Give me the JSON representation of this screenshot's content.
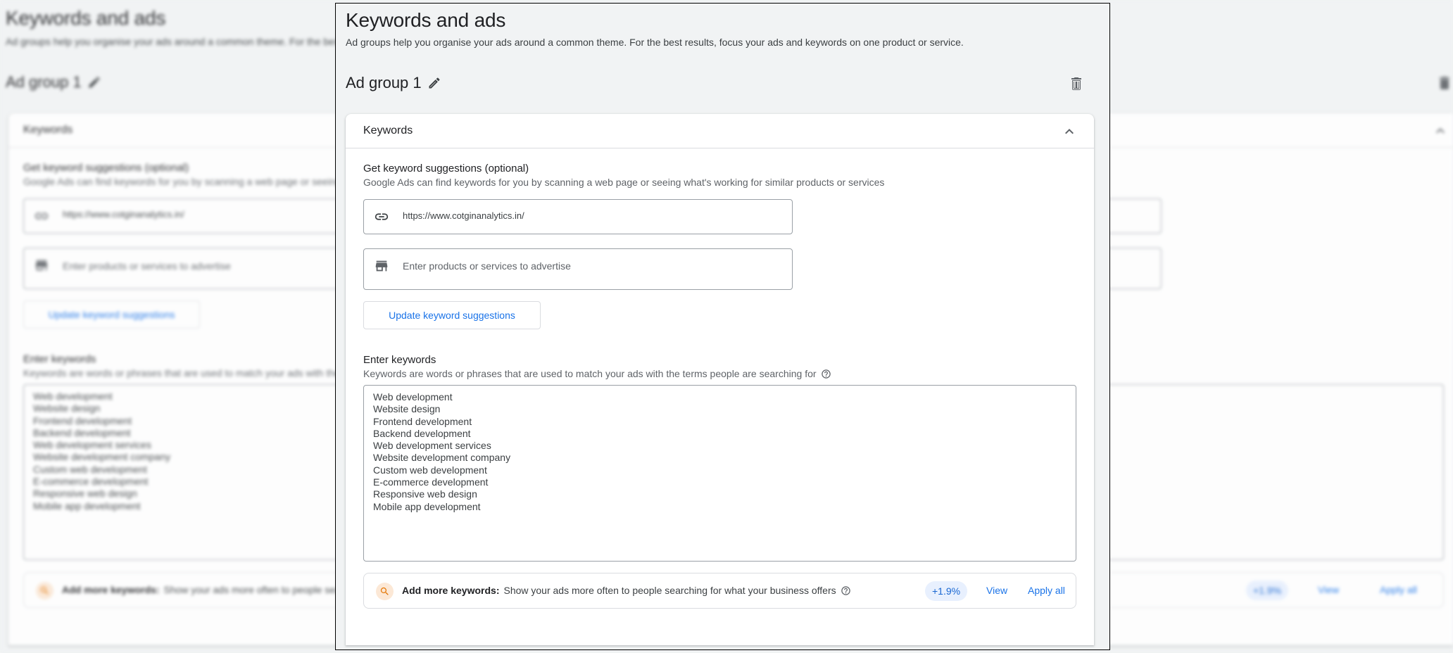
{
  "page": {
    "title": "Keywords and ads",
    "intro": "Ad groups help you organise your ads around a common theme. For the best results, focus your ads and keywords on one product or service."
  },
  "ad_group": {
    "name": "Ad group 1",
    "edit_icon": "pencil-icon",
    "delete_icon": "trash-icon"
  },
  "keywords_card": {
    "title": "Keywords",
    "collapse_icon": "chevron-up-icon",
    "suggestions": {
      "title": "Get keyword suggestions (optional)",
      "description": "Google Ads can find keywords for you by scanning a web page or seeing what's working for similar products or services",
      "url_field": {
        "icon": "link-icon",
        "value": "https://www.cotginanalytics.in/"
      },
      "products_field": {
        "icon": "storefront-icon",
        "value": "",
        "placeholder": "Enter products or services to advertise"
      },
      "update_button": "Update keyword suggestions"
    },
    "enter_keywords": {
      "title": "Enter keywords",
      "description": "Keywords are words or phrases that are used to match your ads with the terms people are searching for",
      "help_icon": "help-circle-icon",
      "keywords": [
        "Web development",
        "Website design",
        "Frontend development",
        "Backend development",
        "Web development services",
        "Website development company",
        "Custom web development",
        "E-commerce development",
        "Responsive web design",
        "Mobile app development"
      ]
    },
    "add_more": {
      "icon": "search-icon",
      "label": "Add more keywords:",
      "text": "Show your ads more often to people searching for what your business offers",
      "uplift": "+1.9%",
      "view": "View",
      "apply_all": "Apply all"
    }
  },
  "colors": {
    "page_bg": "#f1f3f4",
    "accent_blue": "#1a73e8",
    "pill_bg": "#e8f0fe",
    "search_icon_bg": "#fce8d6",
    "search_icon_fg": "#e37400"
  }
}
